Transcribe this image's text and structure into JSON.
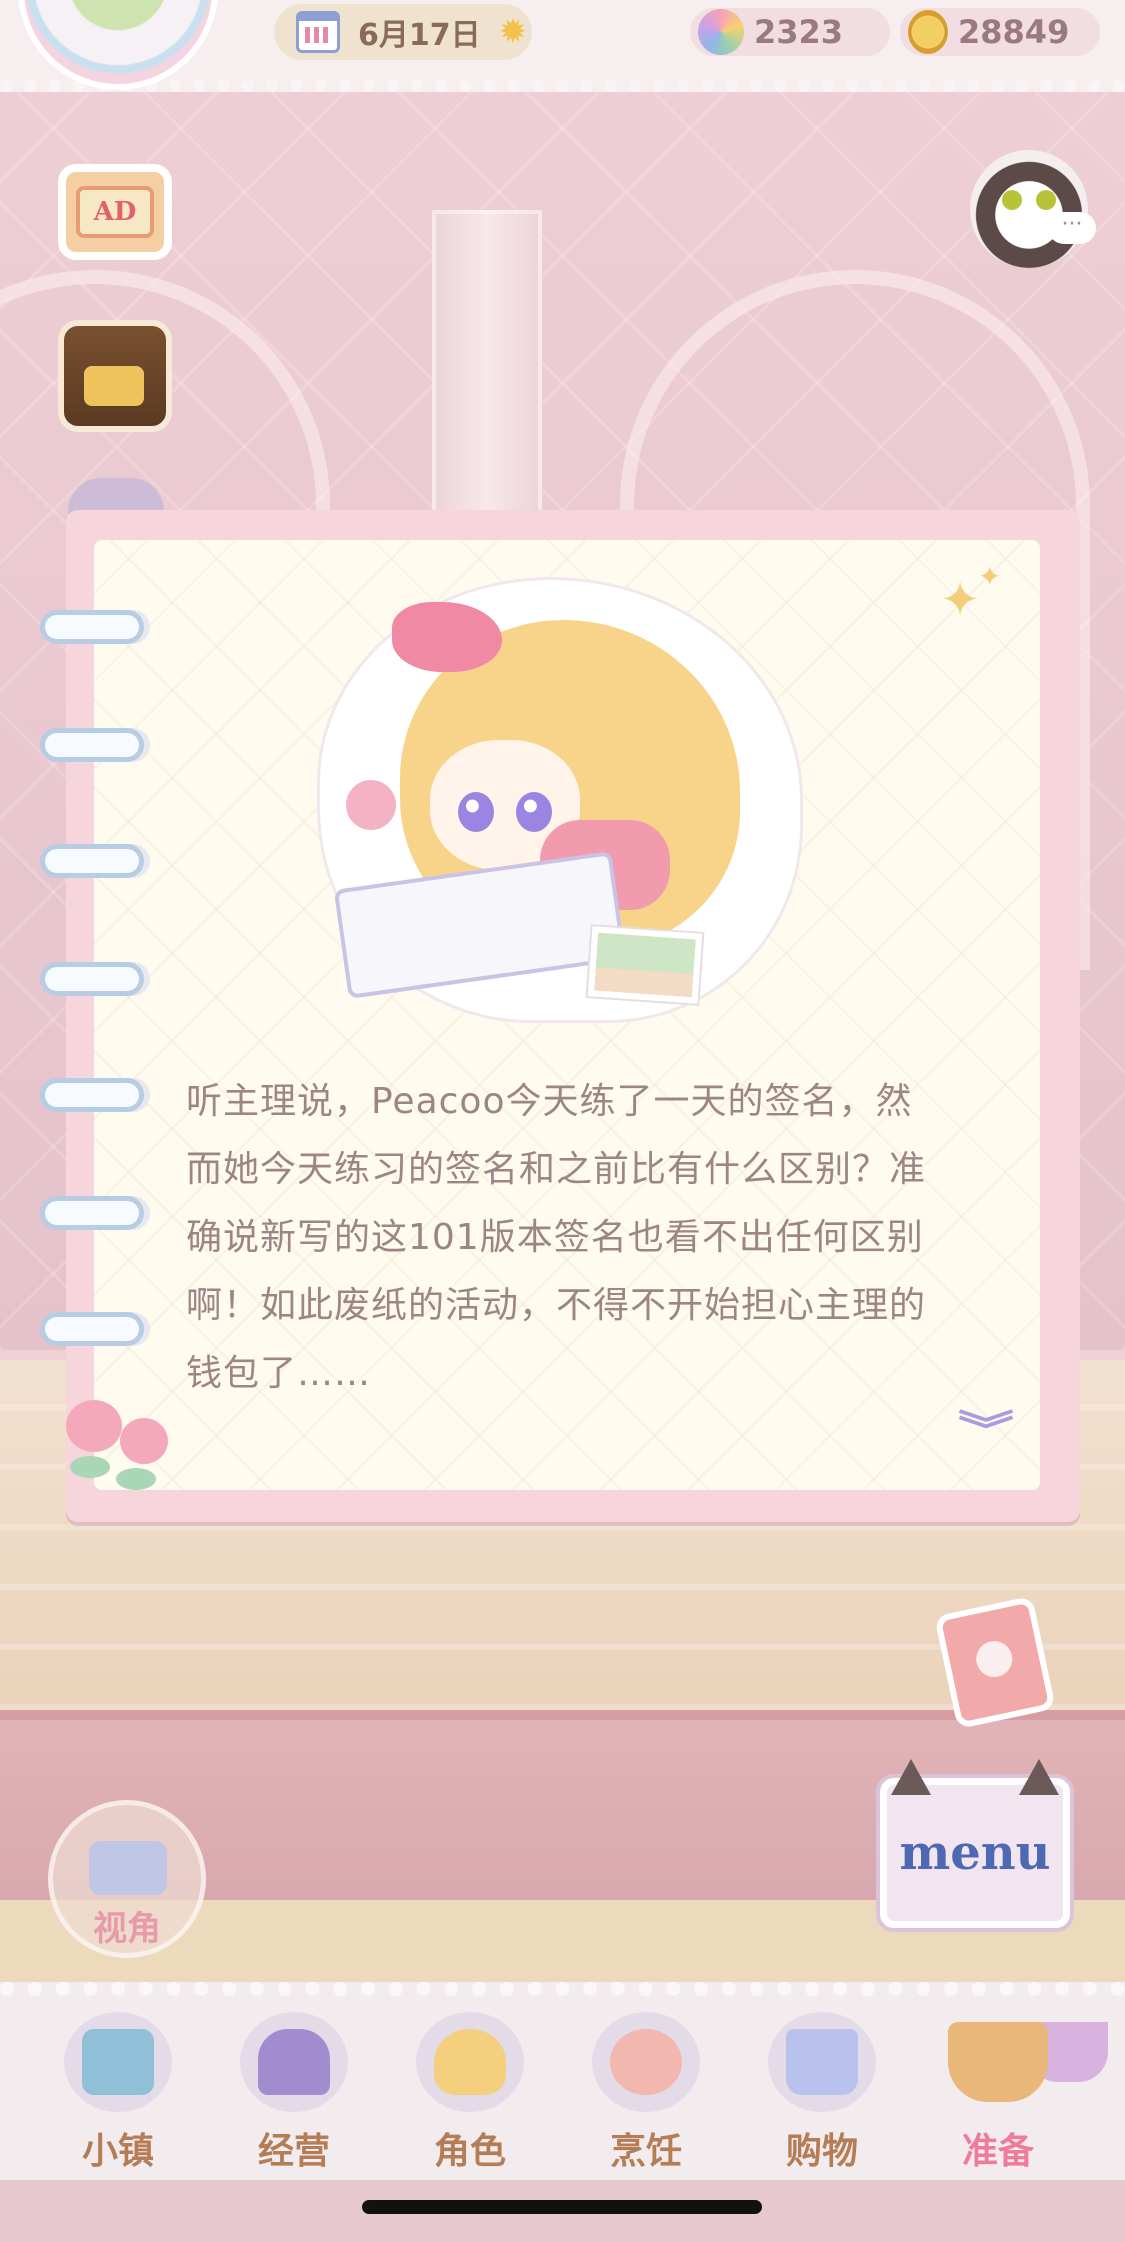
{
  "hud": {
    "date": "6月17日",
    "gems": "2323",
    "coins": "28849"
  },
  "buttons": {
    "ad_label": "AD",
    "menu_label": "menu",
    "camera_label": "视角",
    "chat_dots": "···"
  },
  "dialog": {
    "story_lines": [
      "听主理说，Peacoo今天练了一天的签名，然",
      "而她今天练习的签名和之前比有什么区别？准",
      "确说新写的这101版本签名也看不出任何区别",
      "啊！如此废纸的活动，不得不开始担心主理的",
      "钱包了……"
    ],
    "continue_glyph": "︾"
  },
  "nav": {
    "items": [
      {
        "label": "小镇",
        "icon": "map-icon",
        "color": "#8fc0d8"
      },
      {
        "label": "经营",
        "icon": "shop-lock-icon",
        "color": "#a08ccf"
      },
      {
        "label": "角色",
        "icon": "character-icon",
        "color": "#f3cf7e"
      },
      {
        "label": "烹饪",
        "icon": "sandwich-icon",
        "color": "#f2b8b0"
      },
      {
        "label": "购物",
        "icon": "shopping-bag-icon",
        "color": "#b8c2ec"
      },
      {
        "label": "准备",
        "icon": "basket-icon",
        "color": "#e9b77a"
      }
    ],
    "active_index": 5
  },
  "colors": {
    "accent_pink": "#ef7b9a",
    "label_brown": "#b57d56",
    "story_text": "#9d8486"
  }
}
